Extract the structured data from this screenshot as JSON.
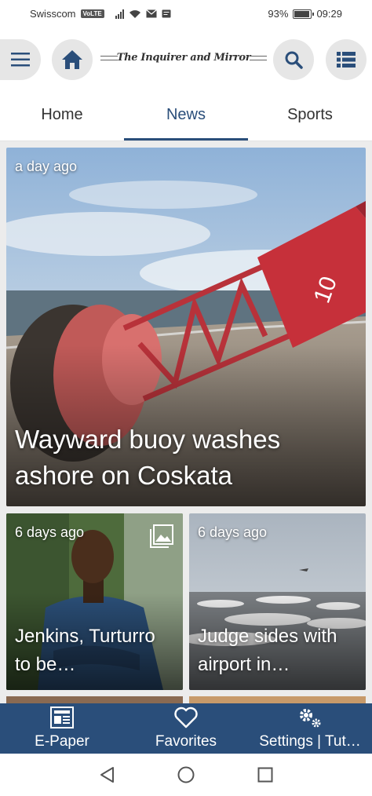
{
  "status_bar": {
    "carrier": "Swisscom",
    "volte": "VoLTE",
    "battery_percent": "93%",
    "battery_level": 0.93,
    "time": "09:29"
  },
  "app_bar": {
    "logo_text": "The Inquirer and Mirror",
    "icons": [
      "hamburger-menu-icon",
      "home-icon",
      "search-icon",
      "list-icon"
    ]
  },
  "tabs": [
    {
      "label": "Home",
      "active": false
    },
    {
      "label": "News",
      "active": true
    },
    {
      "label": "Sports",
      "active": false
    }
  ],
  "feed": {
    "lead": {
      "time": "a day ago",
      "title": "Wayward buoy washes ashore on Coskata"
    },
    "left": {
      "time": "6 days ago",
      "title": "Jenkins, Turturro to be…",
      "gallery_icon": "gallery-icon"
    },
    "right": {
      "time": "6 days ago",
      "title": "Judge sides with airport in…"
    }
  },
  "bottom_nav": [
    {
      "label": "E-Paper",
      "icon": "newspaper-icon"
    },
    {
      "label": "Favorites",
      "icon": "heart-icon"
    },
    {
      "label": "Settings | Tut…",
      "icon": "gears-icon"
    }
  ],
  "system_nav": {
    "buttons": [
      "back-triangle-icon",
      "home-circle-icon",
      "recents-square-icon"
    ]
  },
  "colors": {
    "brand": "#2a4e7a",
    "button_bg": "#e6e6e6",
    "feed_bg": "#ececec"
  }
}
